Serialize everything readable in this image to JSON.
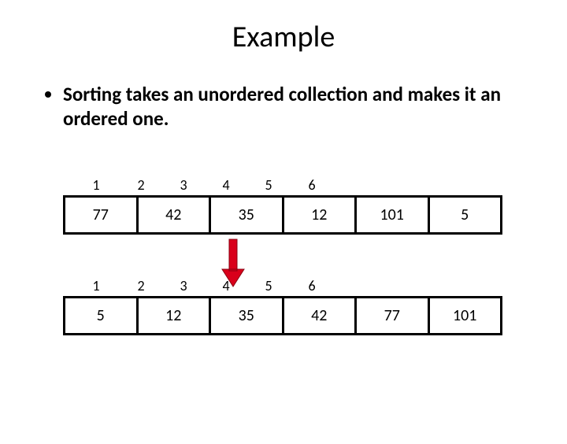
{
  "title": "Example",
  "bullet": "Sorting takes an unordered collection and makes it an ordered one.",
  "indices": [
    "1",
    "2",
    "3",
    "4",
    "5",
    "6"
  ],
  "unsorted": [
    "77",
    "42",
    "35",
    "12",
    "101",
    "5"
  ],
  "sorted": [
    "5",
    "12",
    "35",
    "42",
    "77",
    "101"
  ],
  "arrow_color": "#d9001b"
}
